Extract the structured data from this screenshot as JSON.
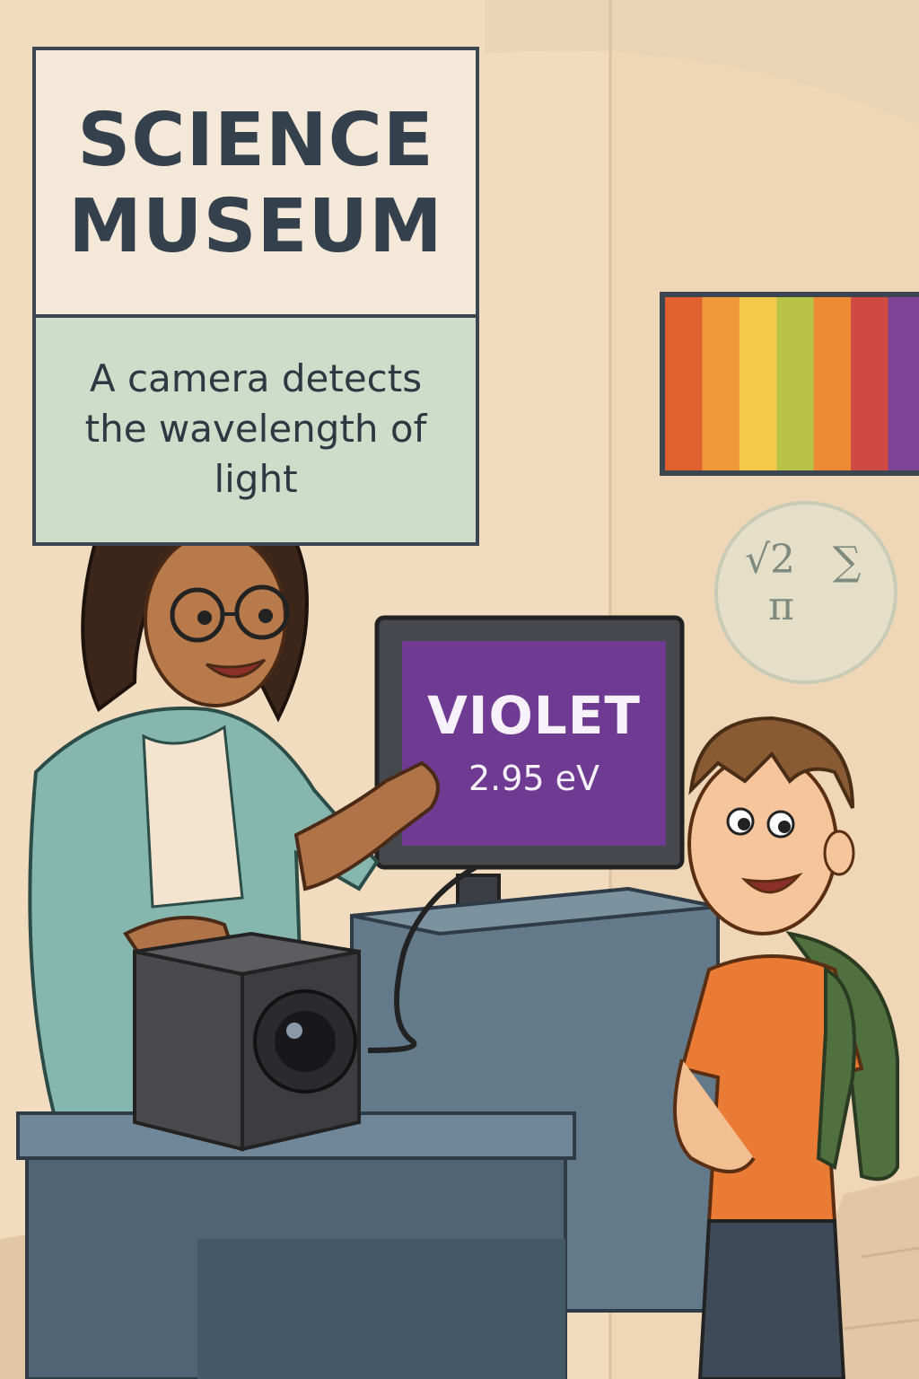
{
  "signs": {
    "title_line1": "SCIENCE",
    "title_line2": "MUSEUM",
    "caption_line1": "A camera detects",
    "caption_line2": "the wavelength of",
    "caption_line3": "light"
  },
  "monitor": {
    "color_label": "VIOLET",
    "energy_readout": "2.95 eV",
    "screen_color": "#6e3a92"
  },
  "poster": {
    "stripe_colors": [
      "#e0612f",
      "#ee9a3a",
      "#f3c94a",
      "#b8c246",
      "#ee8a34",
      "#cf4a43",
      "#7d4496"
    ]
  },
  "math_symbols": {
    "root": "√2",
    "sum": "∑",
    "pi": "π"
  },
  "colors": {
    "wall": "#f2dcc0",
    "pedestal": "#4f6474",
    "teacher_shirt": "#86b7ae",
    "child_shirt": "#ea7b35",
    "backpack": "#51703f"
  }
}
